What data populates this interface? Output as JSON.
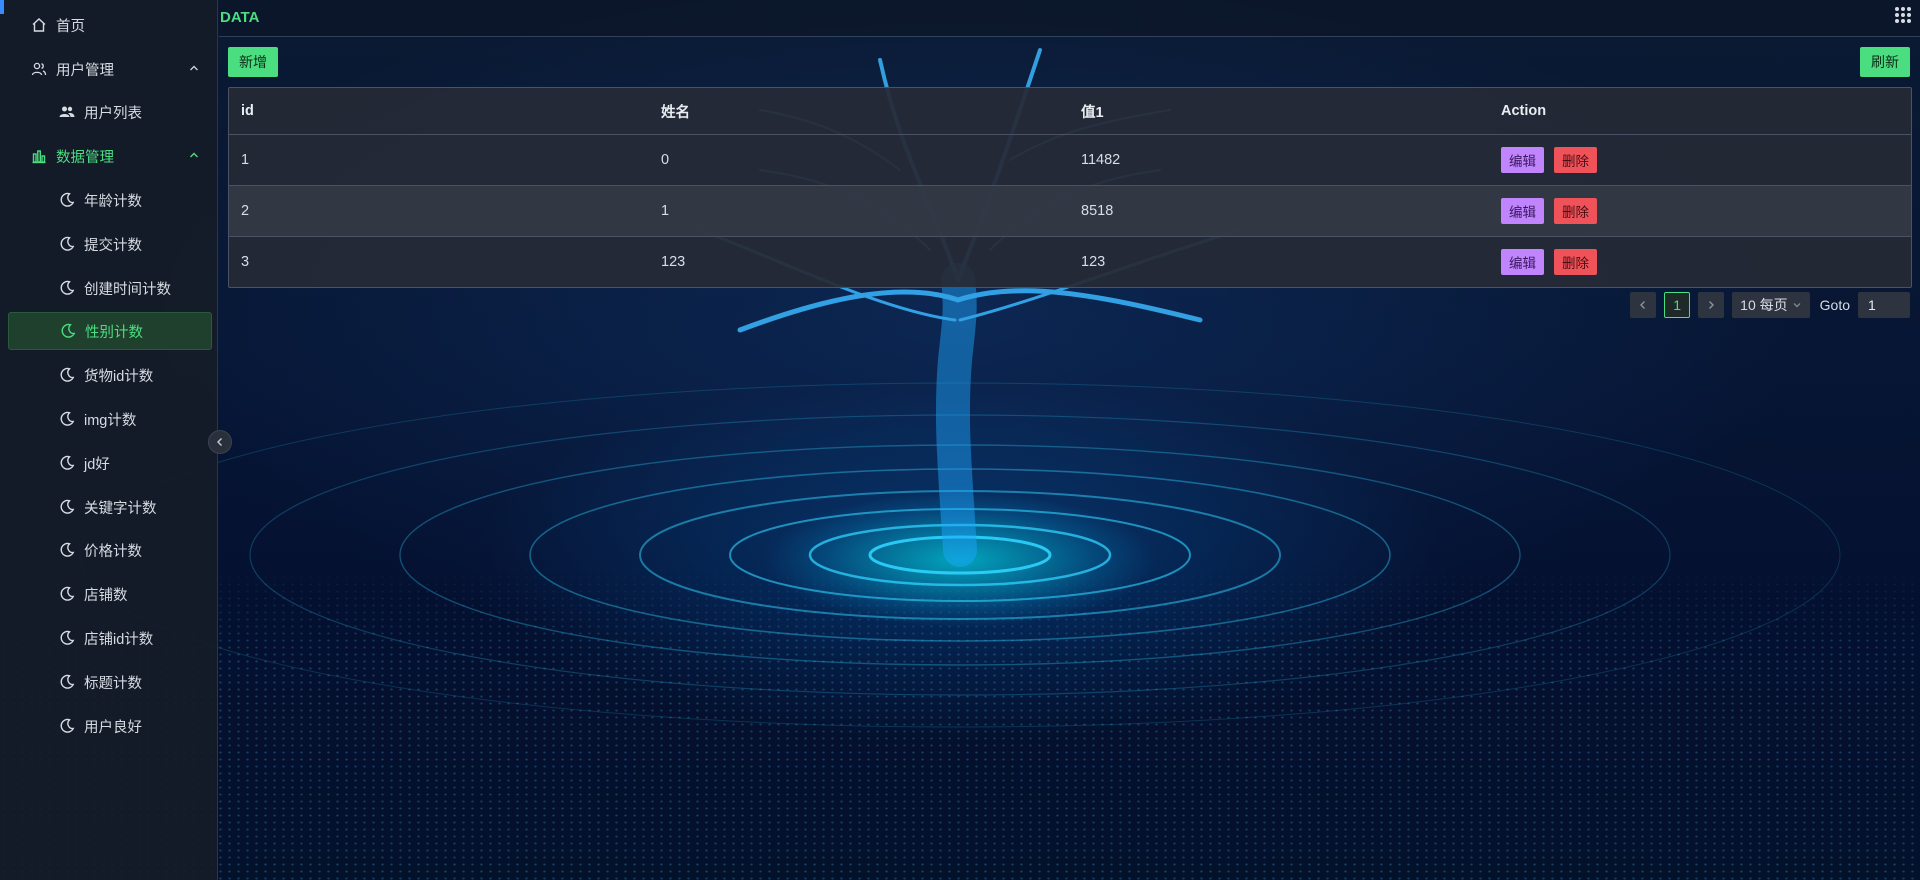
{
  "sidebar": {
    "home": {
      "label": "首页",
      "icon": "home-icon"
    },
    "user_mgmt": {
      "label": "用户管理",
      "icon": "users-icon",
      "expanded": true
    },
    "user_list": {
      "label": "用户列表",
      "icon": "user-group-icon"
    },
    "data_mgmt": {
      "label": "数据管理",
      "icon": "bar-chart-icon",
      "expanded": true
    },
    "items": [
      {
        "label": "年龄计数"
      },
      {
        "label": "提交计数"
      },
      {
        "label": "创建时间计数"
      },
      {
        "label": "性别计数",
        "active": true
      },
      {
        "label": "货物id计数"
      },
      {
        "label": "img计数"
      },
      {
        "label": "jd好"
      },
      {
        "label": "关键字计数"
      },
      {
        "label": "价格计数"
      },
      {
        "label": "店铺数"
      },
      {
        "label": "店铺id计数"
      },
      {
        "label": "标题计数"
      },
      {
        "label": "用户良好"
      }
    ],
    "item_icon": "moon-icon"
  },
  "header": {
    "brand": "DATA",
    "apps_icon": "grid-icon"
  },
  "toolbar": {
    "add_label": "新增",
    "refresh_label": "刷新"
  },
  "table": {
    "columns": [
      "id",
      "姓名",
      "值1",
      "Action"
    ],
    "rows": [
      {
        "id": "1",
        "name": "0",
        "value1": "11482"
      },
      {
        "id": "2",
        "name": "1",
        "value1": "8518"
      },
      {
        "id": "3",
        "name": "123",
        "value1": "123"
      }
    ],
    "edit_label": "编辑",
    "delete_label": "删除"
  },
  "pagination": {
    "current_page": "1",
    "page_size_label": "10 每页",
    "goto_label": "Goto",
    "goto_value": "1"
  },
  "colors": {
    "accent_green": "#4ade80",
    "edit_purple": "#c084fc",
    "delete_red": "#f0525a",
    "sidebar_bg": "#161c28"
  }
}
